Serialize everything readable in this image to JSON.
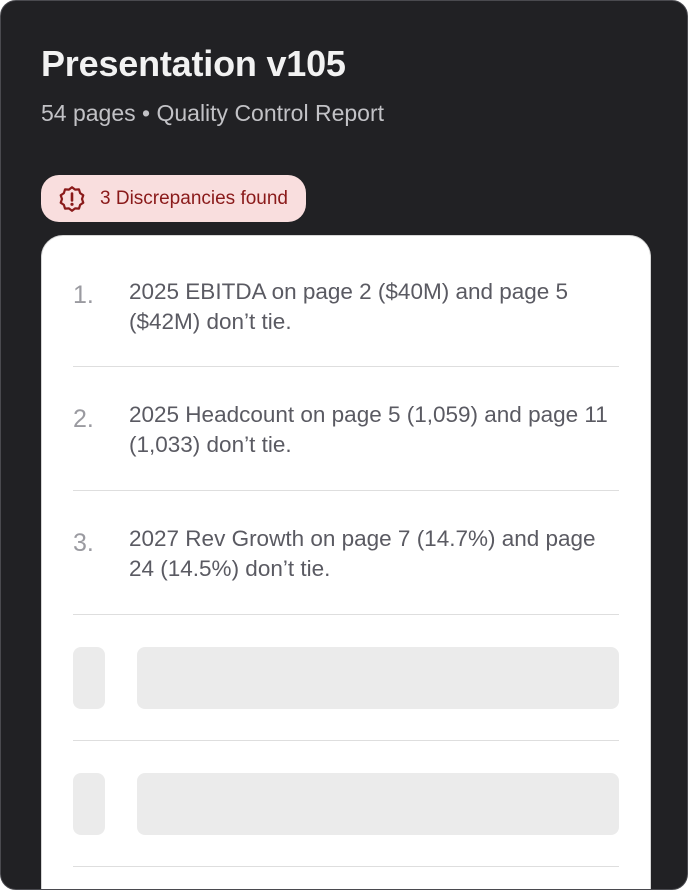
{
  "header": {
    "title": "Presentation v105",
    "subtitle": "54 pages • Quality Control Report"
  },
  "badge": {
    "text": "3 Discrepancies found",
    "icon": "alert-badge-icon",
    "bg_color": "#f9dede",
    "text_color": "#8a1a1a"
  },
  "discrepancies": [
    {
      "number": "1.",
      "text": "2025 EBITDA on page 2 ($40M) and page 5 ($42M) don’t tie."
    },
    {
      "number": "2.",
      "text": "2025 Headcount on page 5 (1,059) and page 11 (1,033) don’t tie."
    },
    {
      "number": "3.",
      "text": "2027 Rev Growth on page 7 (14.7%) and page 24 (14.5%) don’t tie."
    }
  ],
  "colors": {
    "panel_bg": "#212124",
    "card_bg": "#ffffff",
    "skeleton": "#ebebeb"
  }
}
